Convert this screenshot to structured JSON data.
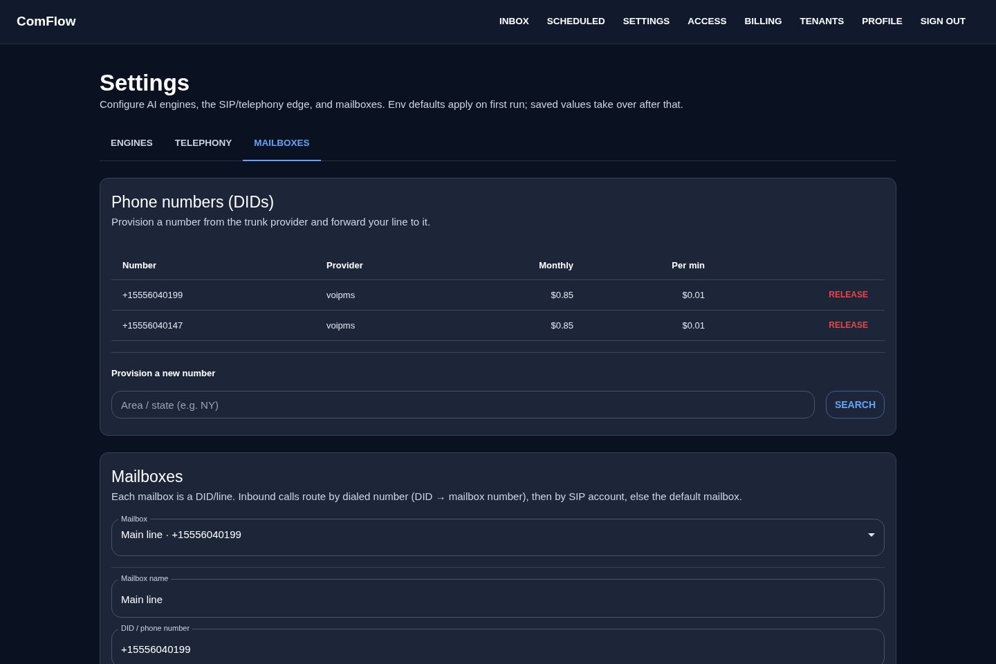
{
  "app": {
    "brand": "ComFlow",
    "nav": [
      "INBOX",
      "SCHEDULED",
      "SETTINGS",
      "ACCESS",
      "BILLING",
      "TENANTS",
      "PROFILE",
      "SIGN OUT"
    ]
  },
  "page": {
    "title": "Settings",
    "subtitle": "Configure AI engines, the SIP/telephony edge, and mailboxes. Env defaults apply on first run; saved values take over after that."
  },
  "tabs": [
    {
      "label": "ENGINES",
      "selected": false
    },
    {
      "label": "TELEPHONY",
      "selected": false
    },
    {
      "label": "MAILBOXES",
      "selected": true
    }
  ],
  "dids": {
    "title": "Phone numbers (DIDs)",
    "subtitle": "Provision a number from the trunk provider and forward your line to it.",
    "columns": [
      "Number",
      "Provider",
      "Monthly",
      "Per min"
    ],
    "rows": [
      {
        "number": "+15556040199",
        "provider": "voipms",
        "monthly": "$0.85",
        "per_min": "$0.01",
        "action": "RELEASE"
      },
      {
        "number": "+15556040147",
        "provider": "voipms",
        "monthly": "$0.85",
        "per_min": "$0.01",
        "action": "RELEASE"
      }
    ],
    "provision_label": "Provision a new number",
    "search_placeholder": "Area / state (e.g. NY)",
    "search_button": "SEARCH"
  },
  "mailboxes": {
    "title": "Mailboxes",
    "subtitle": "Each mailbox is a DID/line. Inbound calls route by dialed number (DID → mailbox number), then by SIP account, else the default mailbox.",
    "select": {
      "label": "Mailbox",
      "value": "Main line · +15556040199"
    },
    "fields": [
      {
        "label": "Mailbox name",
        "value": "Main line"
      },
      {
        "label": "DID / phone number",
        "value": "+15556040199"
      }
    ]
  }
}
